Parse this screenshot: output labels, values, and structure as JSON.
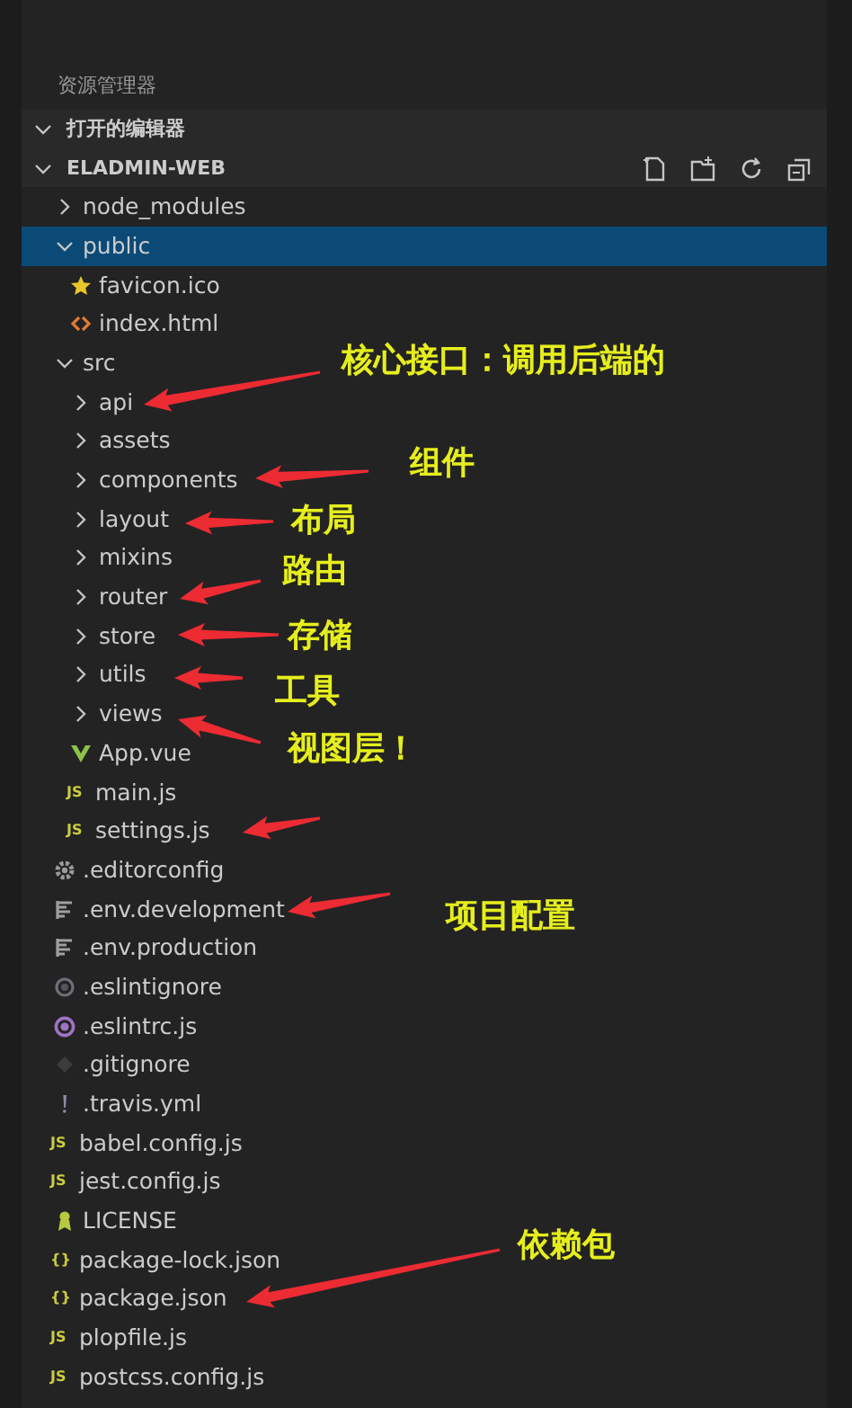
{
  "explorer": {
    "title": "资源管理器",
    "open_editors": {
      "label": "打开的编辑器",
      "expanded": true
    },
    "project": {
      "label": "ELADMIN-WEB",
      "expanded": true
    },
    "tree": [
      {
        "name": "node_modules",
        "kind": "folder",
        "expanded": false,
        "selected": false
      },
      {
        "name": "public",
        "kind": "folder",
        "expanded": true,
        "selected": true,
        "children": [
          {
            "name": "favicon.ico",
            "kind": "star",
            "selected": false
          },
          {
            "name": "index.html",
            "kind": "html",
            "selected": false
          }
        ]
      },
      {
        "name": "src",
        "kind": "folder",
        "expanded": true,
        "selected": false,
        "children": [
          {
            "name": "api",
            "kind": "folder",
            "expanded": false,
            "selected": false
          },
          {
            "name": "assets",
            "kind": "folder",
            "expanded": false,
            "selected": false
          },
          {
            "name": "components",
            "kind": "folder",
            "expanded": false,
            "selected": false
          },
          {
            "name": "layout",
            "kind": "folder",
            "expanded": false,
            "selected": false
          },
          {
            "name": "mixins",
            "kind": "folder",
            "expanded": false,
            "selected": false
          },
          {
            "name": "router",
            "kind": "folder",
            "expanded": false,
            "selected": false
          },
          {
            "name": "store",
            "kind": "folder",
            "expanded": false,
            "selected": false
          },
          {
            "name": "utils",
            "kind": "folder",
            "expanded": false,
            "selected": false
          },
          {
            "name": "views",
            "kind": "folder",
            "expanded": false,
            "selected": false
          },
          {
            "name": "App.vue",
            "kind": "vue",
            "selected": false
          },
          {
            "name": "main.js",
            "kind": "js",
            "icon_text": "JS",
            "selected": false
          },
          {
            "name": "settings.js",
            "kind": "js",
            "icon_text": "JS",
            "selected": false
          }
        ]
      },
      {
        "name": ".editorconfig",
        "kind": "gear",
        "selected": false
      },
      {
        "name": ".env.development",
        "kind": "env",
        "selected": false
      },
      {
        "name": ".env.production",
        "kind": "env",
        "selected": false
      },
      {
        "name": ".eslintignore",
        "kind": "ring",
        "selected": false
      },
      {
        "name": ".eslintrc.js",
        "kind": "eslint",
        "selected": false
      },
      {
        "name": ".gitignore",
        "kind": "git",
        "selected": false
      },
      {
        "name": ".travis.yml",
        "kind": "yaml",
        "selected": false
      },
      {
        "name": "babel.config.js",
        "kind": "js",
        "icon_text": "JS",
        "selected": false
      },
      {
        "name": "jest.config.js",
        "kind": "js",
        "icon_text": "JS",
        "selected": false
      },
      {
        "name": "LICENSE",
        "kind": "license",
        "selected": false
      },
      {
        "name": "package-lock.json",
        "kind": "json",
        "icon_text": "{}",
        "selected": false
      },
      {
        "name": "package.json",
        "kind": "json",
        "icon_text": "{}",
        "selected": false
      },
      {
        "name": "plopfile.js",
        "kind": "js",
        "icon_text": "JS",
        "selected": false
      },
      {
        "name": "postcss.config.js",
        "kind": "js",
        "icon_text": "JS",
        "selected": false
      }
    ]
  },
  "annotations": [
    {
      "kind": "note",
      "text": "核心接口：调用后端的"
    },
    {
      "kind": "note",
      "text": "组件"
    },
    {
      "kind": "note",
      "text": "布局"
    },
    {
      "kind": "note",
      "text": "路由"
    },
    {
      "kind": "note",
      "text": "存储"
    },
    {
      "kind": "note",
      "text": "工具"
    },
    {
      "kind": "note",
      "text": "视图层！"
    },
    {
      "kind": "arrow"
    },
    {
      "kind": "note",
      "text": "项目配置"
    },
    {
      "kind": "note",
      "text": "依赖包"
    }
  ]
}
